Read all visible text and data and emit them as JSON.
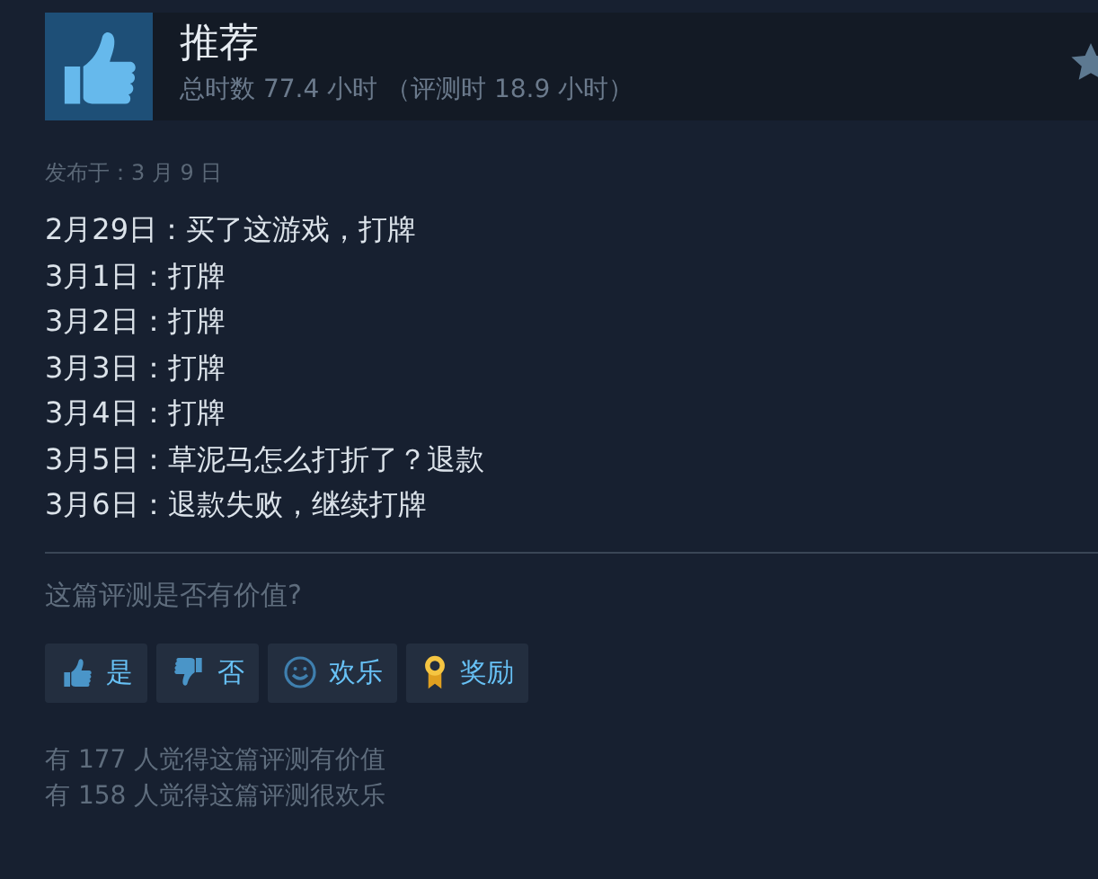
{
  "review": {
    "verdict": "推荐",
    "hours": "总时数 77.4 小时 （评测时 18.9 小时）",
    "posted": "发布于：3 月 9 日",
    "lines": [
      "2月29日：买了这游戏，打牌",
      "3月1日：打牌",
      "3月2日：打牌",
      "3月3日：打牌",
      "3月4日：打牌",
      "3月5日：草泥马怎么打折了？退款",
      "3月6日：退款失败，继续打牌"
    ]
  },
  "feedback": {
    "question": "这篇评测是否有价值?",
    "buttons": [
      {
        "kind": "up",
        "label": "是"
      },
      {
        "kind": "down",
        "label": "否"
      },
      {
        "kind": "smile",
        "label": "欢乐"
      },
      {
        "kind": "award",
        "label": "奖励"
      }
    ],
    "stats": [
      "有 177 人觉得这篇评测有价值",
      "有 158 人觉得这篇评测很欢乐"
    ]
  }
}
